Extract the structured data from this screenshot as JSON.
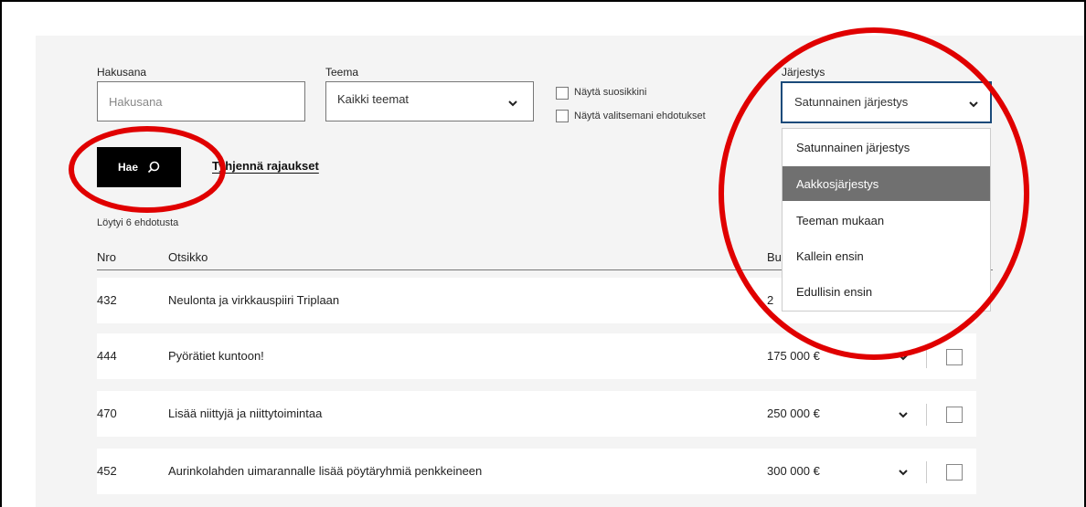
{
  "filters": {
    "search_label": "Hakusana",
    "search_placeholder": "Hakusana",
    "theme_label": "Teema",
    "theme_value": "Kaikki teemat",
    "favorites_label": "Näytä suosikkini",
    "selected_label": "Näytä valitsemani ehdotukset",
    "sort_label": "Järjestys",
    "sort_value": "Satunnainen järjestys"
  },
  "actions": {
    "search_button": "Hae",
    "clear_link": "Tyhjennä rajaukset"
  },
  "results": {
    "count_text": "Löytyi 6 ehdotusta",
    "headers": {
      "number": "Nro",
      "title": "Otsikko",
      "budget": "Bu"
    },
    "rows": [
      {
        "number": "432",
        "title": "Neulonta ja virkkauspiiri Triplaan",
        "budget": "2"
      },
      {
        "number": "444",
        "title": "Pyörätiet kuntoon!",
        "budget": "175 000 €"
      },
      {
        "number": "470",
        "title": "Lisää niittyjä ja niittytoimintaa",
        "budget": "250 000 €"
      },
      {
        "number": "452",
        "title": "Aurinkolahden uimarannalle lisää pöytäryhmiä penkkeineen",
        "budget": "300 000 €"
      }
    ]
  },
  "sort_dropdown": {
    "options": [
      {
        "label": "Satunnainen järjestys",
        "active": false
      },
      {
        "label": "Aakkosjärjestys",
        "active": true
      },
      {
        "label": "Teeman mukaan",
        "active": false
      },
      {
        "label": "Kallein ensin",
        "active": false
      },
      {
        "label": "Edullisin ensin",
        "active": false
      }
    ]
  },
  "colors": {
    "highlight_circle": "#e00000",
    "active_option_bg": "#707070",
    "focus_border": "#1a4a7a"
  }
}
